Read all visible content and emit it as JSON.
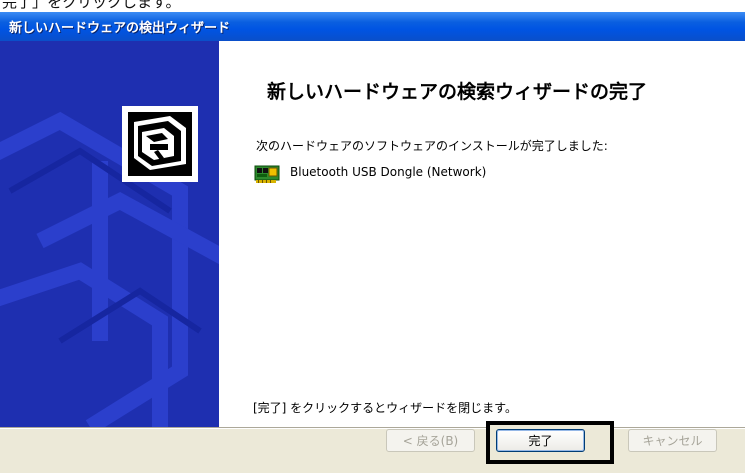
{
  "top_caption": "完了」をクリックします。",
  "window": {
    "title": "新しいハードウェアの検出ウィザード"
  },
  "content": {
    "heading": "新しいハードウェアの検索ウィザードの完了",
    "message": "次のハードウェアのソフトウェアのインストールが完了しました:",
    "device_name": "Bluetooth USB Dongle (Network)",
    "finish_message": "[完了] をクリックするとウィザードを閉じます。"
  },
  "buttons": {
    "back": "< 戻る(B)",
    "finish": "完了",
    "cancel": "キャンセル"
  },
  "icons": {
    "wizard": "hardware-wizard-icon",
    "device": "network-card-icon"
  },
  "colors": {
    "titlebar": "#0054e3",
    "sidebar": "#1a2aa8",
    "dialog_bg": "#ece9d8",
    "highlight_frame": "#000000"
  }
}
